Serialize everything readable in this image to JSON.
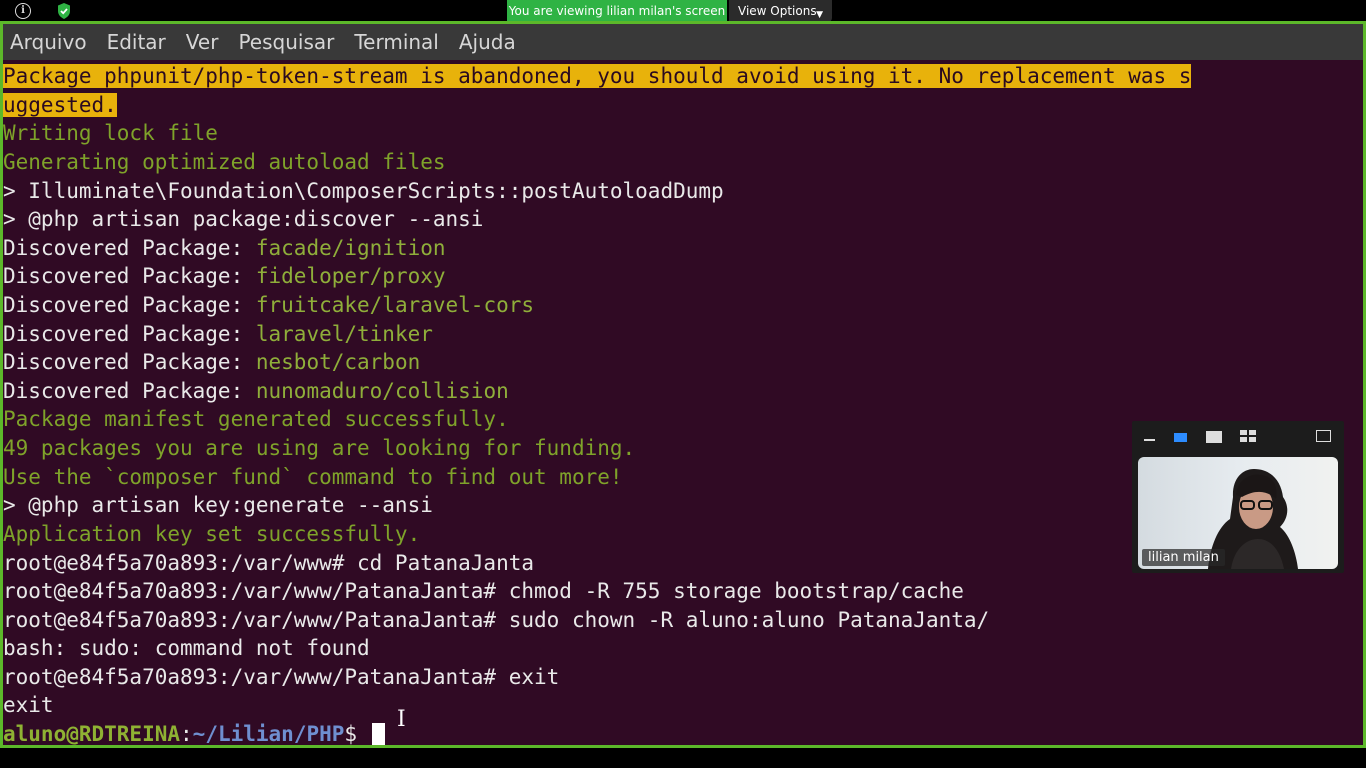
{
  "zoom": {
    "banner": "You are viewing lilian milan's screen",
    "view_options": "View Options",
    "info_icon": "info-icon",
    "shield_icon": "shield-icon",
    "banner_color": "#2fb344",
    "frame_color": "#5cb82a"
  },
  "terminal": {
    "menu": [
      "Arquivo",
      "Editar",
      "Ver",
      "Pesquisar",
      "Terminal",
      "Ajuda"
    ],
    "background": "#300a24",
    "lines": {
      "l0": "Package phpunit/php-token-stream is abandoned, you should avoid using it. No replacement was s",
      "l1": "uggested.",
      "l2": "Writing lock file",
      "l3": "Generating optimized autoload files",
      "l4": "> Illuminate\\Foundation\\ComposerScripts::postAutoloadDump",
      "l5": "> @php artisan package:discover --ansi",
      "discovered_label": "Discovered Package: ",
      "packages": [
        "facade/ignition",
        "fideloper/proxy",
        "fruitcake/laravel-cors",
        "laravel/tinker",
        "nesbot/carbon",
        "nunomaduro/collision"
      ],
      "l12": "Package manifest generated successfully.",
      "l13": "49 packages you are using are looking for funding.",
      "l14": "Use the `composer fund` command to find out more!",
      "l15": "> @php artisan key:generate --ansi",
      "l16": "Application key set successfully.",
      "l17": "root@e84f5a70a893:/var/www# cd PatanaJanta",
      "l18": "root@e84f5a70a893:/var/www/PatanaJanta# chmod -R 755 storage bootstrap/cache",
      "l19": "root@e84f5a70a893:/var/www/PatanaJanta# sudo chown -R aluno:aluno PatanaJanta/",
      "l20": "bash: sudo: command not found",
      "l21": "root@e84f5a70a893:/var/www/PatanaJanta# exit",
      "l22": "exit",
      "prompt_user": "aluno@RDTREINA",
      "prompt_sep": ":",
      "prompt_path": "~/Lilian/PHP",
      "prompt_end": "$ "
    }
  },
  "video": {
    "participant": "lilian milan",
    "toolbar_icons": [
      "minimize-icon",
      "speaker-view-icon",
      "gallery-icon",
      "grid-icon",
      "expand-icon"
    ]
  }
}
